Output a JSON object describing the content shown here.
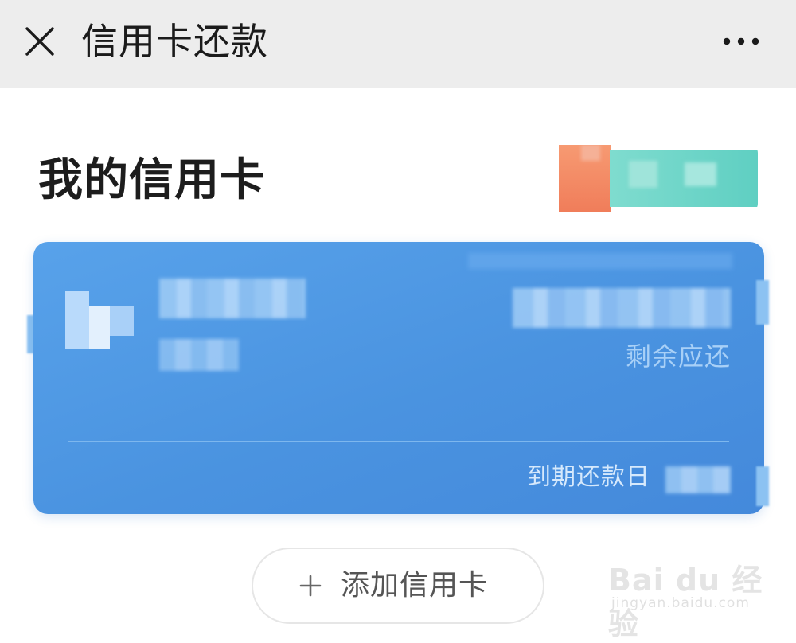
{
  "nav": {
    "title": "信用卡还款",
    "close_icon": "close-icon",
    "more_icon": "more-horizontal-icon"
  },
  "section": {
    "title": "我的信用卡"
  },
  "card": {
    "remaining_label": "剩余应还",
    "due_date_label": "到期还款日",
    "background_color": "#4a93e0"
  },
  "add_card": {
    "label": "添加信用卡",
    "icon": "plus-icon"
  },
  "watermark": {
    "brand": "Bai du 经验",
    "url": "jingyan.baidu.com"
  }
}
